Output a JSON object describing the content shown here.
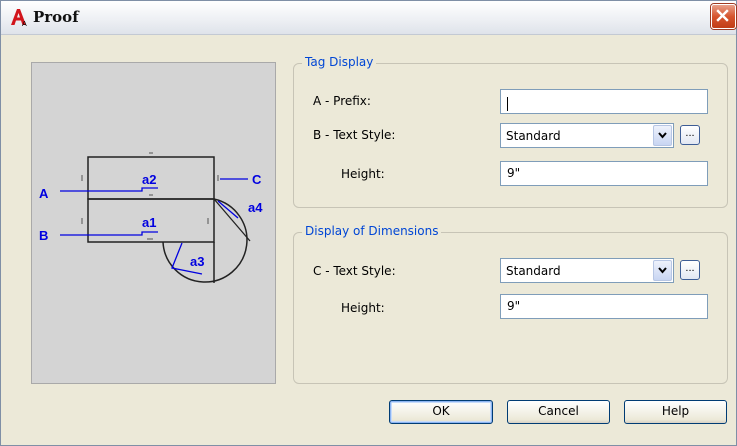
{
  "window": {
    "title": "Proof",
    "icon": "autocad-a-icon",
    "close_icon": "close-icon"
  },
  "preview": {
    "labels": {
      "A": "A",
      "B": "B",
      "C": "C"
    },
    "tags": {
      "a1": "a1",
      "a2": "a2",
      "a3": "a3",
      "a4": "a4"
    }
  },
  "tag_display": {
    "title": "Tag Display",
    "prefix_label": "A - Prefix:",
    "prefix_value": "",
    "text_style_label": "B - Text Style:",
    "text_style_value": "Standard",
    "height_label": "Height:",
    "height_value": "9\""
  },
  "display_dimensions": {
    "title": "Display of Dimensions",
    "text_style_label": "C - Text Style:",
    "text_style_value": "Standard",
    "height_label": "Height:",
    "height_value": "9\""
  },
  "ellipsis_label": "...",
  "buttons": {
    "ok": "OK",
    "cancel": "Cancel",
    "help": "Help"
  },
  "colors": {
    "group_title": "#0046d5",
    "drawing_blue": "#0000e0",
    "close_red": "#d6552f"
  }
}
